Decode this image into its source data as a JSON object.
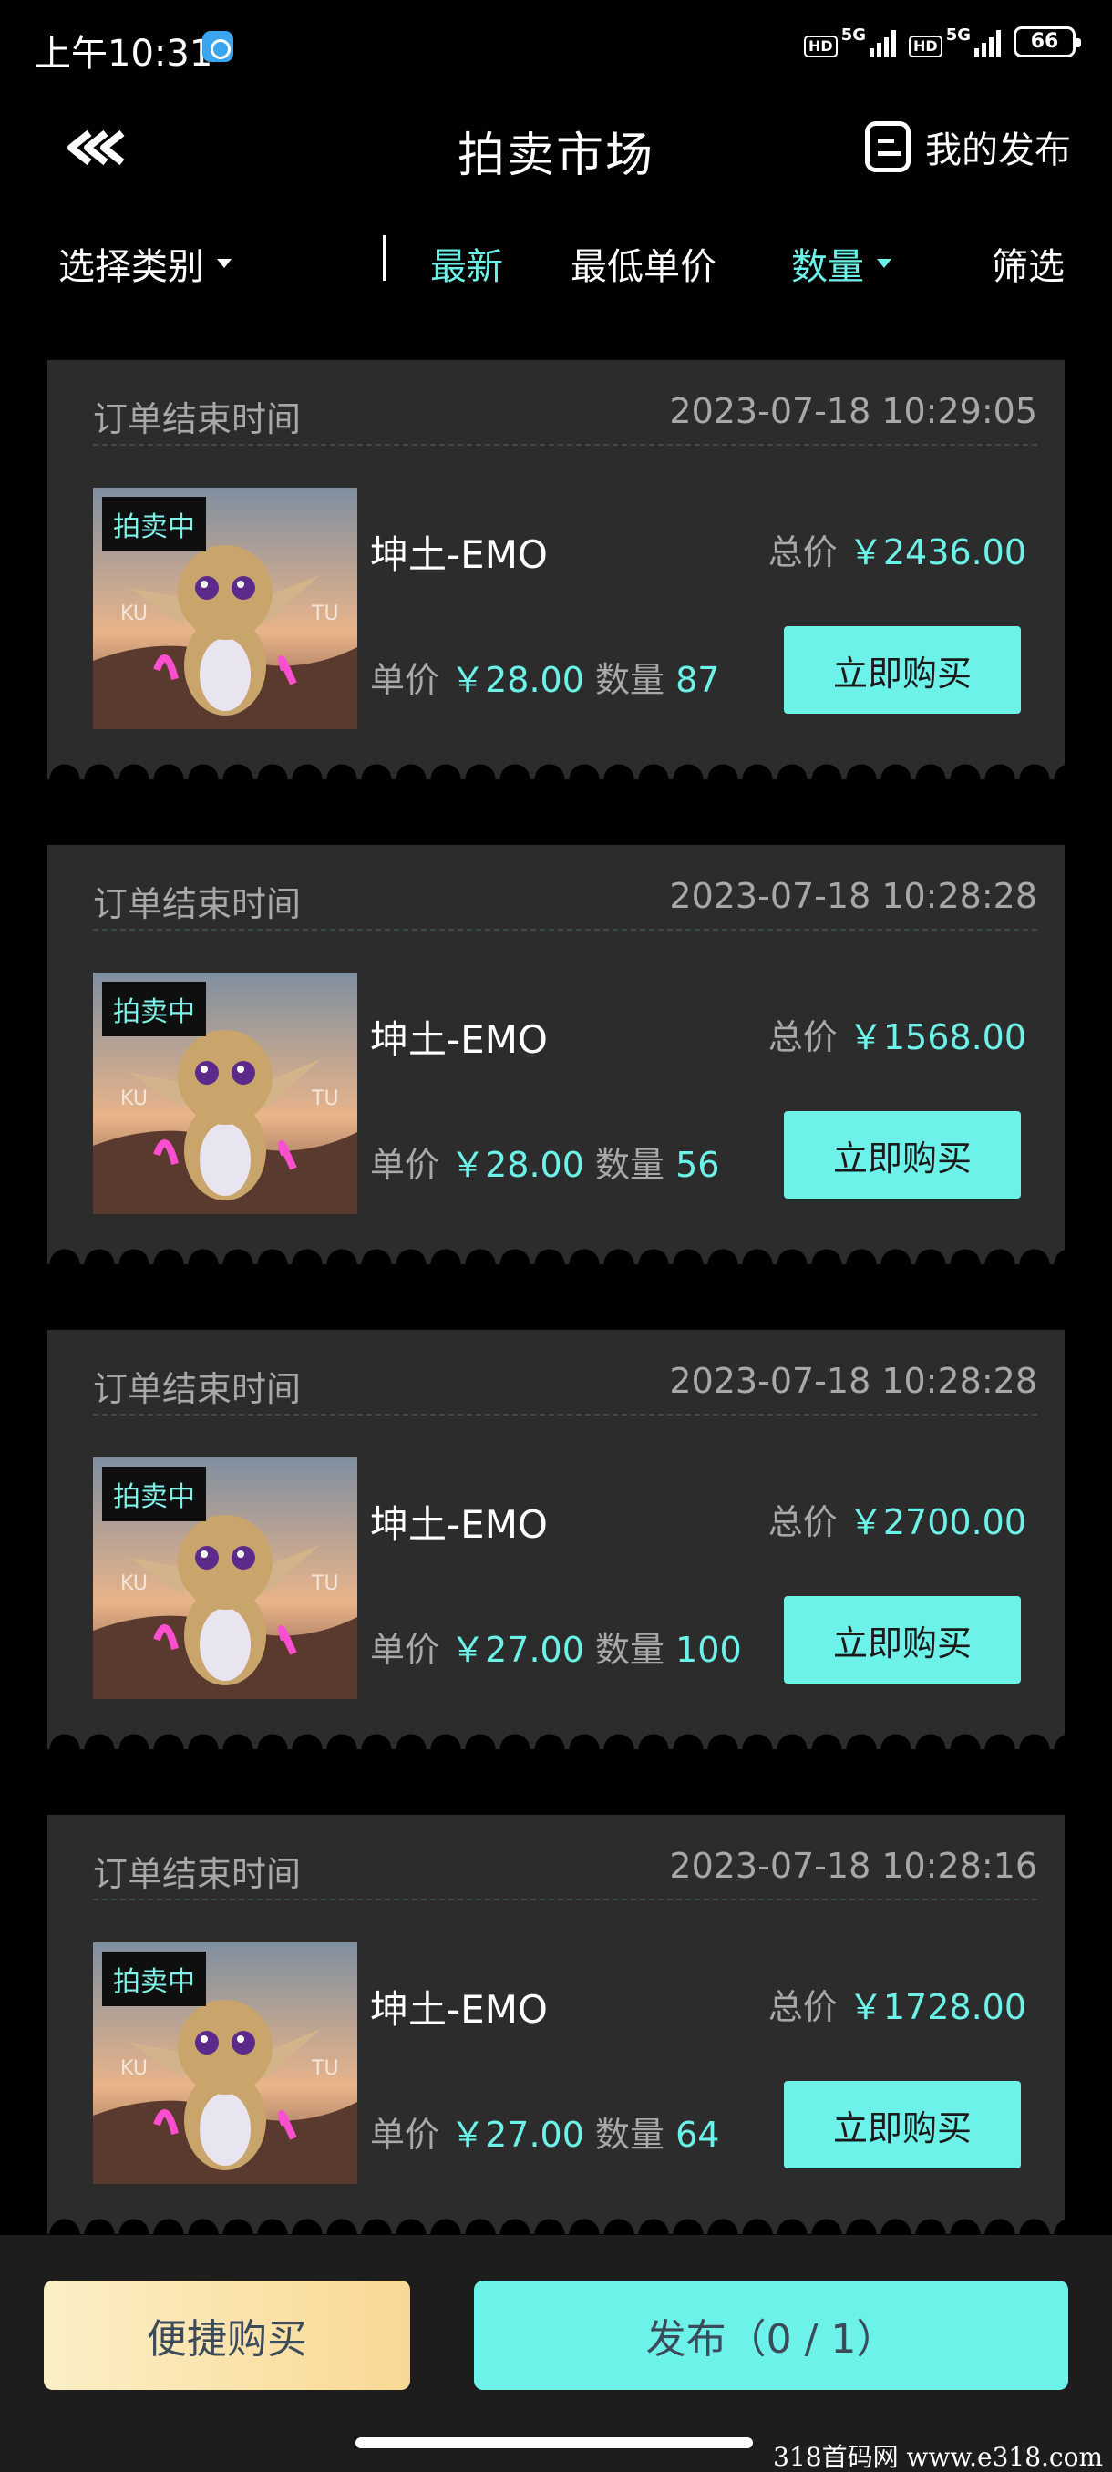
{
  "status": {
    "time": "上午10:31",
    "hd": "HD",
    "network": "5G",
    "battery": "66"
  },
  "header": {
    "title": "拍卖市场",
    "my_publish": "我的发布"
  },
  "filters": {
    "category": "选择类别",
    "latest": "最新",
    "lowest_price": "最低单价",
    "quantity": "数量",
    "filter": "筛选",
    "active_color": "#6cf2e8"
  },
  "cards": [
    {
      "end_label": "订单结束时间",
      "end_time": "2023-07-18 10:29:05",
      "badge": "拍卖中",
      "name": "坤土-EMO",
      "total_label": "总价",
      "total": "￥2436.00",
      "unit_label": "单价",
      "unit_price": "￥28.00",
      "qty_label": "数量",
      "qty": "87",
      "buy_label": "立即购买"
    },
    {
      "end_label": "订单结束时间",
      "end_time": "2023-07-18 10:28:28",
      "badge": "拍卖中",
      "name": "坤土-EMO",
      "total_label": "总价",
      "total": "￥1568.00",
      "unit_label": "单价",
      "unit_price": "￥28.00",
      "qty_label": "数量",
      "qty": "56",
      "buy_label": "立即购买"
    },
    {
      "end_label": "订单结束时间",
      "end_time": "2023-07-18 10:28:28",
      "badge": "拍卖中",
      "name": "坤土-EMO",
      "total_label": "总价",
      "total": "￥2700.00",
      "unit_label": "单价",
      "unit_price": "￥27.00",
      "qty_label": "数量",
      "qty": "100",
      "buy_label": "立即购买"
    },
    {
      "end_label": "订单结束时间",
      "end_time": "2023-07-18 10:28:16",
      "badge": "拍卖中",
      "name": "坤土-EMO",
      "total_label": "总价",
      "total": "￥1728.00",
      "unit_label": "单价",
      "unit_price": "￥27.00",
      "qty_label": "数量",
      "qty": "64",
      "buy_label": "立即购买"
    }
  ],
  "thumb_text": {
    "left": "KU",
    "right": "TU"
  },
  "bottom": {
    "quick_buy": "便捷购买",
    "publish": "发布（0 / 1）"
  },
  "watermark": "318首码网  www.e318.com",
  "icons": {
    "back": "back-chevrons-icon",
    "publish": "document-icon",
    "dropdown": "triangle-down-icon"
  },
  "colors": {
    "accent": "#6cf2e8",
    "card_bg": "#2c2c2c",
    "gold_start": "#fbefc6",
    "gold_end": "#fad894"
  }
}
